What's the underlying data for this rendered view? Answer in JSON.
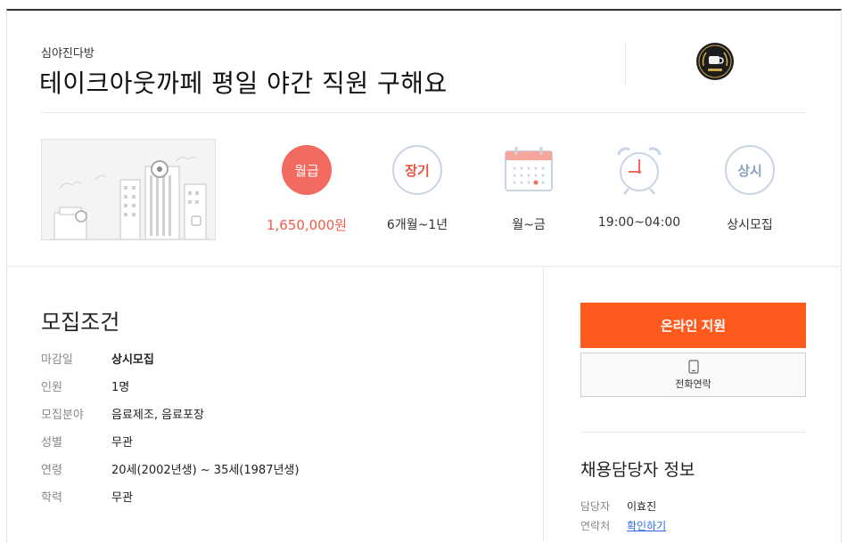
{
  "header": {
    "company": "심야진다방",
    "title": "테이크아웃까페 평일 야간 직원 구해요"
  },
  "conditions": [
    {
      "badge": "월급",
      "value": "1,650,000원"
    },
    {
      "badge": "장기",
      "value": "6개월~1년"
    },
    {
      "badge": "",
      "value": "월~금"
    },
    {
      "badge": "",
      "value": "19:00~04:00"
    },
    {
      "badge": "상시",
      "value": "상시모집"
    }
  ],
  "requirements": {
    "title": "모집조건",
    "rows": [
      {
        "key": "마감일",
        "value": "상시모집"
      },
      {
        "key": "인원",
        "value": "1명"
      },
      {
        "key": "모집분야",
        "value": "음료제조, 음료포장"
      },
      {
        "key": "성별",
        "value": "무관"
      },
      {
        "key": "연령",
        "value": "20세(2002년생) ~ 35세(1987년생)"
      },
      {
        "key": "학력",
        "value": "무관"
      }
    ]
  },
  "actions": {
    "apply_label": "온라인 지원",
    "phone_label": "전화연락"
  },
  "manager": {
    "title": "채용담당자 정보",
    "name_key": "담당자",
    "name_value": "이효진",
    "contact_key": "연락처",
    "contact_value": "확인하기"
  },
  "colors": {
    "accent": "#ff5a1e",
    "salary_badge": "#f26a60",
    "badge_outline": "#c8d4e4",
    "badge_text": "#e5533f",
    "link": "#2f6ee5"
  }
}
